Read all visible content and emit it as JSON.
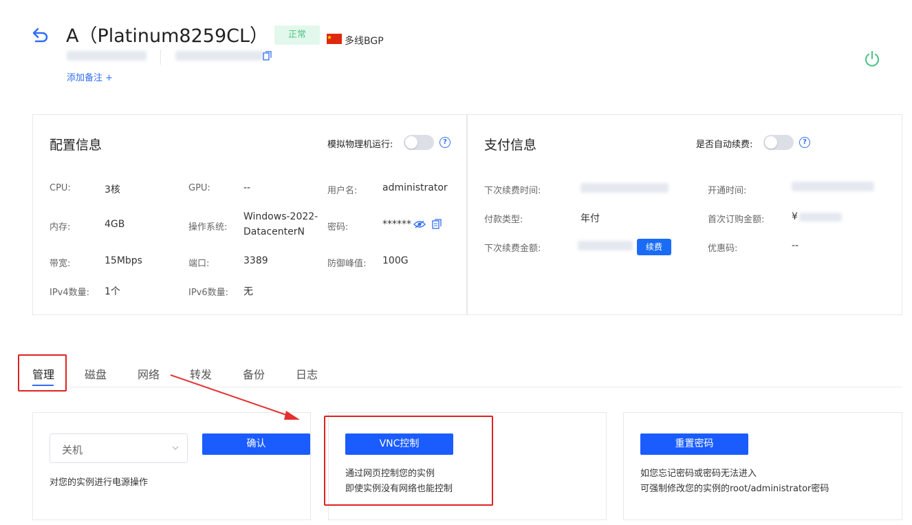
{
  "header": {
    "title": "A（Platinum8259CL）",
    "status": "正常",
    "region": "多线BGP",
    "add_remark": "添加备注 +"
  },
  "config_panel": {
    "title": "配置信息",
    "toggle_label": "模拟物理机运行:",
    "toggle_on": false,
    "rows": {
      "cpu_label": "CPU:",
      "cpu_value": "3核",
      "gpu_label": "GPU:",
      "gpu_value": "--",
      "user_label": "用户名:",
      "user_value": "administrator",
      "mem_label": "内存:",
      "mem_value": "4GB",
      "os_label": "操作系统:",
      "os_value_1": "Windows-2022-",
      "os_value_2": "DatacenterN",
      "pwd_label": "密码:",
      "pwd_value": "******",
      "bw_label": "带宽:",
      "bw_value": "15Mbps",
      "port_label": "端口:",
      "port_value": "3389",
      "ddos_label": "防御峰值:",
      "ddos_value": "100G",
      "ipv4_label": "IPv4数量:",
      "ipv4_value": "1个",
      "ipv6_label": "IPv6数量:",
      "ipv6_value": "无"
    }
  },
  "pay_panel": {
    "title": "支付信息",
    "toggle_label": "是否自动续费:",
    "toggle_on": false,
    "next_renew_time_label": "下次续费时间:",
    "open_time_label": "开通时间:",
    "pay_type_label": "付款类型:",
    "pay_type_value": "年付",
    "first_amount_label": "首次订购金额:",
    "first_amount_prefix": "¥",
    "next_amount_label": "下次续费金额:",
    "renew_button": "续费",
    "coupon_label": "优惠码:",
    "coupon_value": "--"
  },
  "tabs": [
    "管理",
    "磁盘",
    "网络",
    "转发",
    "备份",
    "日志"
  ],
  "power_card": {
    "select_value": "关机",
    "confirm": "确认",
    "desc": "对您的实例进行电源操作"
  },
  "vnc_card": {
    "button": "VNC控制",
    "desc_1": "通过网页控制您的实例",
    "desc_2": "即使实例没有网络也能控制"
  },
  "reset_card": {
    "button": "重置密码",
    "desc_1": "如您忘记密码或密码无法进入",
    "desc_2": "可强制修改您的实例的root/administrator密码"
  },
  "colors": {
    "primary": "#1a5cff",
    "status_green": "#52c489",
    "highlight_red": "#e02020"
  }
}
